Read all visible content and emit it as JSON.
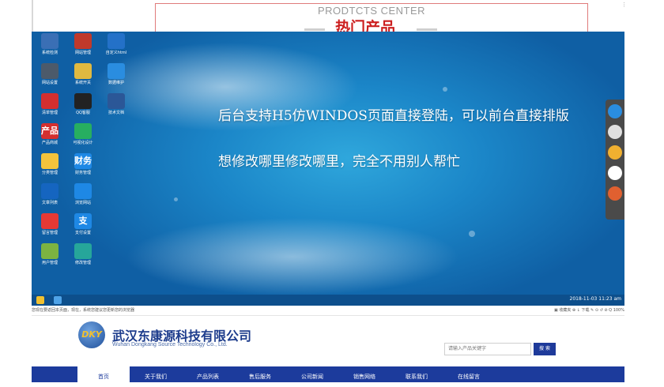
{
  "background_page": {
    "section_en": "PRODTCTS CENTER",
    "section_cn": "热门产品",
    "side_mark": "⋮"
  },
  "desktop": {
    "icons": [
      {
        "label": "系统检测",
        "icon": "monitor-icon",
        "color": "#3a6fb5"
      },
      {
        "label": "网站管理",
        "icon": "globe-icon",
        "color": "#c0392b"
      },
      {
        "label": "自定义html",
        "icon": "star-icon",
        "color": "#2471c8"
      },
      {
        "label": "网站设置",
        "icon": "gear-icon",
        "color": "#4c5a6a"
      },
      {
        "label": "系统开关",
        "icon": "notepad-icon",
        "color": "#e0b940"
      },
      {
        "label": "数据维护",
        "icon": "signal-icon",
        "color": "#2a8de0"
      },
      {
        "label": "清单管理",
        "icon": "cart-icon",
        "color": "#d32f2f"
      },
      {
        "label": "QQ客服",
        "icon": "penguin-icon",
        "color": "#222222"
      },
      {
        "label": "技术文档",
        "icon": "word-icon",
        "color": "#2b5797"
      },
      {
        "label": "产品商城",
        "icon": "shop-icon",
        "color": "#d32f2f",
        "text": "产品"
      },
      {
        "label": "可视化设计",
        "icon": "window-icon",
        "color": "#27ae60"
      },
      {
        "label": "",
        "icon": "",
        "color": ""
      },
      {
        "label": "分类管理",
        "icon": "folder-icon",
        "color": "#f3c33c"
      },
      {
        "label": "财务管理",
        "icon": "finance-icon",
        "color": "#1e88e5",
        "text": "财务"
      },
      {
        "label": "",
        "icon": "",
        "color": ""
      },
      {
        "label": "文章列表",
        "icon": "list-icon",
        "color": "#1565c0"
      },
      {
        "label": "浏览网站",
        "icon": "ie-icon",
        "color": "#1e88e5"
      },
      {
        "label": "",
        "icon": "",
        "color": ""
      },
      {
        "label": "留言管理",
        "icon": "message-icon",
        "color": "#e53935"
      },
      {
        "label": "支付设置",
        "icon": "alipay-icon",
        "color": "#1e88e5",
        "text": "支"
      },
      {
        "label": "",
        "icon": "",
        "color": ""
      },
      {
        "label": "用户管理",
        "icon": "users-icon",
        "color": "#7cb342"
      },
      {
        "label": "修改管理",
        "icon": "chat-icon",
        "color": "#26a69a"
      }
    ],
    "line1": "后台支持H5仿WINDOS页面直接登陆，可以前台直接排版",
    "line2": "想修改哪里修改哪里，完全不用别人帮忙",
    "clock": "2018-11-03 11:23 am",
    "dock_icons": [
      "info-icon",
      "settings-icon",
      "people-icon",
      "mail-icon",
      "support-icon"
    ]
  },
  "statusbar": {
    "left": "您现在要返回本页面，现在，系统您建议您更新您的浏览器",
    "right": "▣ 收藏夹  ⊕  ↓ 下载  ✎  ⊙  ↺  ⊘  Q 100%"
  },
  "header": {
    "logo_text": "DKY",
    "company_cn": "武汉东康源科技有限公司",
    "company_en": "Wuhan Dongkang Source Technology Co., Ltd.",
    "search_placeholder": "请输入产品关键字",
    "search_button": "搜 索"
  },
  "nav": [
    {
      "label": "首页",
      "active": true
    },
    {
      "label": "关于我们"
    },
    {
      "label": "产品列表"
    },
    {
      "label": "售后服务"
    },
    {
      "label": "公司新闻"
    },
    {
      "label": "销售网络"
    },
    {
      "label": "联系我们"
    },
    {
      "label": "在线留言"
    }
  ],
  "colors": {
    "nav_bg": "#1c3b9c",
    "brand_red": "#cc1f1f",
    "desktop_blue": "#1b86c8"
  }
}
